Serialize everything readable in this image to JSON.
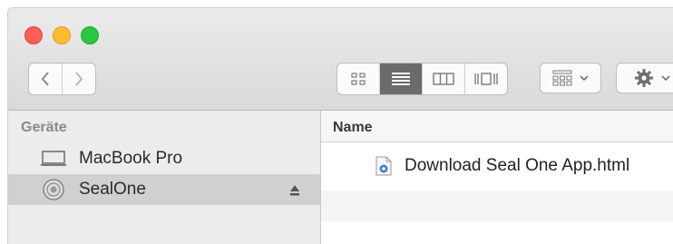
{
  "sidebar": {
    "heading": "Geräte",
    "items": [
      {
        "label": "MacBook Pro",
        "icon": "laptop-icon"
      },
      {
        "label": "SealOne",
        "icon": "disk-icon",
        "selected": true,
        "ejectable": true
      }
    ]
  },
  "toolbar": {
    "view_modes": [
      "icon-view",
      "list-view",
      "column-view",
      "cover-flow-view"
    ],
    "active_view": "list-view"
  },
  "main": {
    "column_name": "Name",
    "files": [
      {
        "name": "Download Seal One App.html",
        "icon": "html-file-icon"
      }
    ]
  },
  "colors": {
    "close": "#fc5f57",
    "minimize": "#fdbb2e",
    "zoom": "#28c840",
    "selection": "#d0d0d0"
  }
}
